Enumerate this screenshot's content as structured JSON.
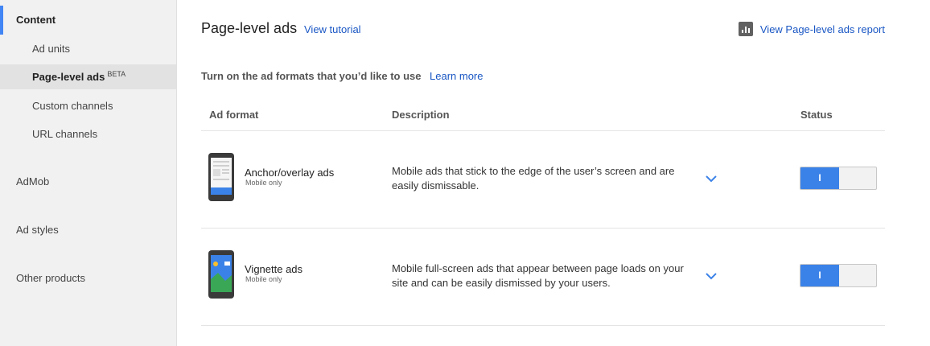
{
  "sidebar": {
    "content_label": "Content",
    "items": [
      {
        "label": "Ad units"
      },
      {
        "label": "Page-level ads",
        "badge": "BETA"
      },
      {
        "label": "Custom channels"
      },
      {
        "label": "URL channels"
      }
    ],
    "sections": [
      {
        "label": "AdMob"
      },
      {
        "label": "Ad styles"
      },
      {
        "label": "Other products"
      }
    ]
  },
  "header": {
    "title": "Page-level ads",
    "tutorial_link": "View tutorial",
    "report_link": "View Page-level ads report",
    "report_icon": "bar-chart-icon"
  },
  "intro": {
    "text": "Turn on the ad formats that you’d like to use",
    "learn_more": "Learn more"
  },
  "table": {
    "columns": [
      "Ad format",
      "Description",
      "Status"
    ],
    "rows": [
      {
        "name": "Anchor/overlay ads",
        "sub": "Mobile only",
        "description": "Mobile ads that stick to the edge of the user’s screen and are easily dismissable.",
        "status_label": "I",
        "status_on": true,
        "icon": "anchor-ad-phone-icon"
      },
      {
        "name": "Vignette ads",
        "sub": "Mobile only",
        "description": "Mobile full-screen ads that appear between page loads on your site and can be easily dismissed by your users.",
        "status_label": "I",
        "status_on": true,
        "icon": "vignette-ad-phone-icon"
      }
    ]
  },
  "colors": {
    "accent": "#4285f4",
    "link": "#1a57c4",
    "toggle_on": "#3b82e8",
    "sidebar_bg": "#f1f1f1",
    "sidebar_selected": "#e2e2e2"
  }
}
